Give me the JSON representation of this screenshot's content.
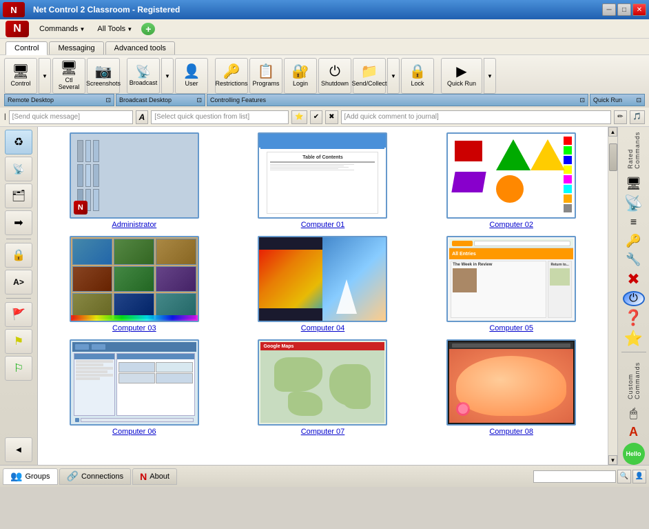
{
  "app": {
    "title": "Net Control 2 Classroom - Registered",
    "logo": "N"
  },
  "window_buttons": {
    "minimize": "─",
    "maximize": "□",
    "close": "✕"
  },
  "menu": {
    "commands_label": "Commands",
    "tools_label": "All Tools",
    "add_btn": "+"
  },
  "tabs": [
    {
      "label": "Control",
      "active": true
    },
    {
      "label": "Messaging",
      "active": false
    },
    {
      "label": "Advanced tools",
      "active": false
    }
  ],
  "toolbar": {
    "buttons": [
      {
        "id": "control",
        "label": "Control",
        "icon": "🖥"
      },
      {
        "id": "ctl-several",
        "label": "Ctl Several",
        "icon": "🖥"
      },
      {
        "id": "screenshots",
        "label": "Screenshots",
        "icon": "📷"
      },
      {
        "id": "broadcast",
        "label": "Broadcast",
        "icon": "📡"
      },
      {
        "id": "user",
        "label": "User",
        "icon": "👤"
      },
      {
        "id": "restrictions",
        "label": "Restrictions",
        "icon": "🔑"
      },
      {
        "id": "programs",
        "label": "Programs",
        "icon": "📋"
      },
      {
        "id": "login",
        "label": "Login",
        "icon": "🔐"
      },
      {
        "id": "shutdown",
        "label": "Shutdown",
        "icon": "⏻"
      },
      {
        "id": "send-collect",
        "label": "Send/Collect",
        "icon": "📁"
      },
      {
        "id": "lock",
        "label": "Lock",
        "icon": "🔒"
      },
      {
        "id": "quick-run",
        "label": "Quick Run",
        "icon": "▶"
      }
    ],
    "groups": [
      {
        "label": "Remote Desktop",
        "span": 3
      },
      {
        "label": "Broadcast Desktop",
        "span": 2
      },
      {
        "label": "Controlling Features",
        "span": 6
      },
      {
        "label": "Quick Run",
        "span": 1
      }
    ]
  },
  "quickbar": {
    "message_placeholder": "[Send quick message]",
    "font_icon": "A",
    "question_placeholder": "[Select quick question from list]",
    "journal_placeholder": "[Add quick comment to journal]"
  },
  "computers": [
    {
      "id": "admin",
      "label": "Administrator",
      "thumb_type": "files"
    },
    {
      "id": "comp01",
      "label": "Computer 01",
      "thumb_type": "document"
    },
    {
      "id": "comp02",
      "label": "Computer 02",
      "thumb_type": "shapes"
    },
    {
      "id": "comp03",
      "label": "Computer 03",
      "thumb_type": "photos"
    },
    {
      "id": "comp04",
      "label": "Computer 04",
      "thumb_type": "heatmap"
    },
    {
      "id": "comp05",
      "label": "Computer 05",
      "thumb_type": "browser"
    },
    {
      "id": "comp06",
      "label": "Computer 06",
      "thumb_type": "table"
    },
    {
      "id": "comp07",
      "label": "Computer 07",
      "thumb_type": "maps"
    },
    {
      "id": "comp08",
      "label": "Computer 08",
      "thumb_type": "cat"
    }
  ],
  "left_sidebar": {
    "buttons": [
      {
        "icon": "♻",
        "label": "refresh"
      },
      {
        "icon": "📡",
        "label": "broadcast"
      },
      {
        "icon": "🗂",
        "label": "apps"
      },
      {
        "icon": "➡",
        "label": "forward"
      },
      {
        "icon": "🔒",
        "label": "lock"
      },
      {
        "icon": "A>",
        "label": "text"
      },
      {
        "icon": "🚩",
        "label": "flag-red"
      },
      {
        "icon": "⚑",
        "label": "flag-yellow"
      },
      {
        "icon": "⚐",
        "label": "flag-green"
      }
    ]
  },
  "right_sidebar": {
    "top_label": "Rated Commands",
    "bottom_label": "Custom Commands",
    "buttons": [
      {
        "icon": "🖥",
        "label": "monitor"
      },
      {
        "icon": "📡",
        "label": "broadcast"
      },
      {
        "icon": "≡",
        "label": "list"
      },
      {
        "icon": "🔑",
        "label": "key"
      },
      {
        "icon": "🔧",
        "label": "wrench"
      },
      {
        "icon": "❌",
        "label": "cancel"
      },
      {
        "icon": "⏻",
        "label": "power"
      },
      {
        "icon": "❓",
        "label": "question"
      },
      {
        "icon": "⭐",
        "label": "star"
      },
      {
        "icon": "🖱",
        "label": "cursor"
      },
      {
        "icon": "🔤",
        "label": "text"
      },
      {
        "icon": "👋",
        "label": "hello"
      }
    ]
  },
  "statusbar": {
    "tabs": [
      {
        "label": "Groups",
        "icon": "👥",
        "active": true
      },
      {
        "label": "Connections",
        "icon": "🔗",
        "active": false
      },
      {
        "label": "About",
        "icon": "N",
        "active": false
      }
    ]
  }
}
